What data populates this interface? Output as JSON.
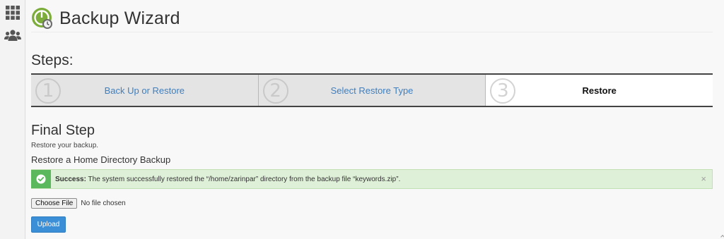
{
  "sidebar": {
    "items": [
      {
        "icon": "grid-icon"
      },
      {
        "icon": "users-icon"
      }
    ]
  },
  "header": {
    "title": "Backup Wizard",
    "logo_icon": "backup-wizard-icon"
  },
  "steps": {
    "heading": "Steps:",
    "items": [
      {
        "number": "1",
        "label": "Back Up or Restore",
        "active": false
      },
      {
        "number": "2",
        "label": "Select Restore Type",
        "active": false
      },
      {
        "number": "3",
        "label": "Restore",
        "active": true
      }
    ]
  },
  "final": {
    "heading": "Final Step",
    "description": "Restore your backup.",
    "section_title": "Restore a Home Directory Backup"
  },
  "alert": {
    "label": "Success:",
    "message": " The system successfully restored the “/home/zarinpar” directory from the backup file “keywords.zip”.",
    "close": "×",
    "color": "#5cb85c"
  },
  "file_input": {
    "button_label": "Choose File",
    "status": "No file chosen"
  },
  "upload": {
    "label": "Upload",
    "color": "#3b8fd6"
  }
}
